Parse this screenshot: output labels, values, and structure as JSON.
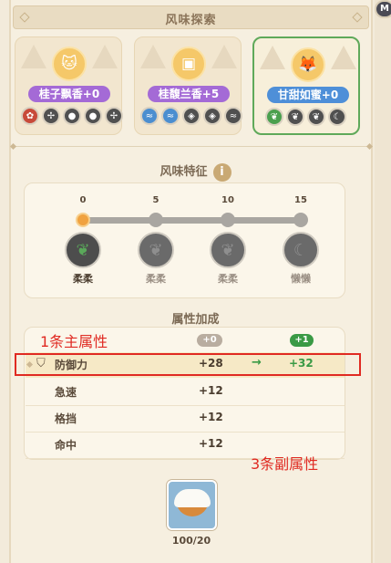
{
  "header": {
    "title": "风味探索",
    "corner": "M"
  },
  "flavors": [
    {
      "label": "桂子飘香+0",
      "label_color": "#a46ad6",
      "icon": "cat-icon",
      "glyph": "🐱",
      "selected": false,
      "icons": [
        {
          "name": "flame-icon",
          "color": "#c84a3a",
          "g": "✿"
        },
        {
          "name": "fan-icon",
          "color": "#505050",
          "g": "✢"
        },
        {
          "name": "drop-icon",
          "color": "#505050",
          "g": "●"
        },
        {
          "name": "drop-icon",
          "color": "#505050",
          "g": "●"
        },
        {
          "name": "fan-icon",
          "color": "#505050",
          "g": "✢"
        }
      ]
    },
    {
      "label": "桂馥兰香+5",
      "label_color": "#a46ad6",
      "icon": "box-icon",
      "glyph": "▣",
      "selected": false,
      "icons": [
        {
          "name": "wave-icon",
          "color": "#4b8ed0",
          "g": "≈"
        },
        {
          "name": "wave-icon",
          "color": "#4b8ed0",
          "g": "≈"
        },
        {
          "name": "shield-icon",
          "color": "#505050",
          "g": "◈"
        },
        {
          "name": "shield-icon",
          "color": "#505050",
          "g": "◈"
        },
        {
          "name": "wave-icon",
          "color": "#505050",
          "g": "≈"
        }
      ]
    },
    {
      "label": "甘甜如蜜+0",
      "label_color": "#4e8fd8",
      "icon": "fox-icon",
      "glyph": "🦊",
      "selected": true,
      "icons": [
        {
          "name": "leaf-icon",
          "color": "#4aa04e",
          "g": "❦"
        },
        {
          "name": "leaf-icon",
          "color": "#505050",
          "g": "❦"
        },
        {
          "name": "leaf-icon",
          "color": "#505050",
          "g": "❦"
        },
        {
          "name": "moon-icon",
          "color": "#505050",
          "g": "☾"
        }
      ]
    }
  ],
  "traits_section": {
    "title": "风味特征",
    "info": "i"
  },
  "traits": [
    {
      "value": "0",
      "name": "柔柔",
      "icon": "leaf-icon",
      "glyph": "❦",
      "active": true
    },
    {
      "value": "5",
      "name": "柔柔",
      "icon": "leaf-icon",
      "glyph": "❦",
      "active": false
    },
    {
      "value": "10",
      "name": "柔柔",
      "icon": "leaf-icon",
      "glyph": "❦",
      "active": false
    },
    {
      "value": "15",
      "name": "懒懒",
      "icon": "moon-icon",
      "glyph": "☾",
      "active": false
    }
  ],
  "attributes_section": {
    "title": "属性加成",
    "pill_current": "+0",
    "pill_next": "+1"
  },
  "main_attr": {
    "label": "防御力",
    "value": "+28",
    "arrow": "→",
    "next": "+32"
  },
  "sub_attrs": [
    {
      "label": "急速",
      "value": "+12"
    },
    {
      "label": "格挡",
      "value": "+12"
    },
    {
      "label": "命中",
      "value": "+12"
    }
  ],
  "annotations": {
    "main": "1条主属性",
    "sub": "3条副属性"
  },
  "item": {
    "count": "100/20"
  }
}
